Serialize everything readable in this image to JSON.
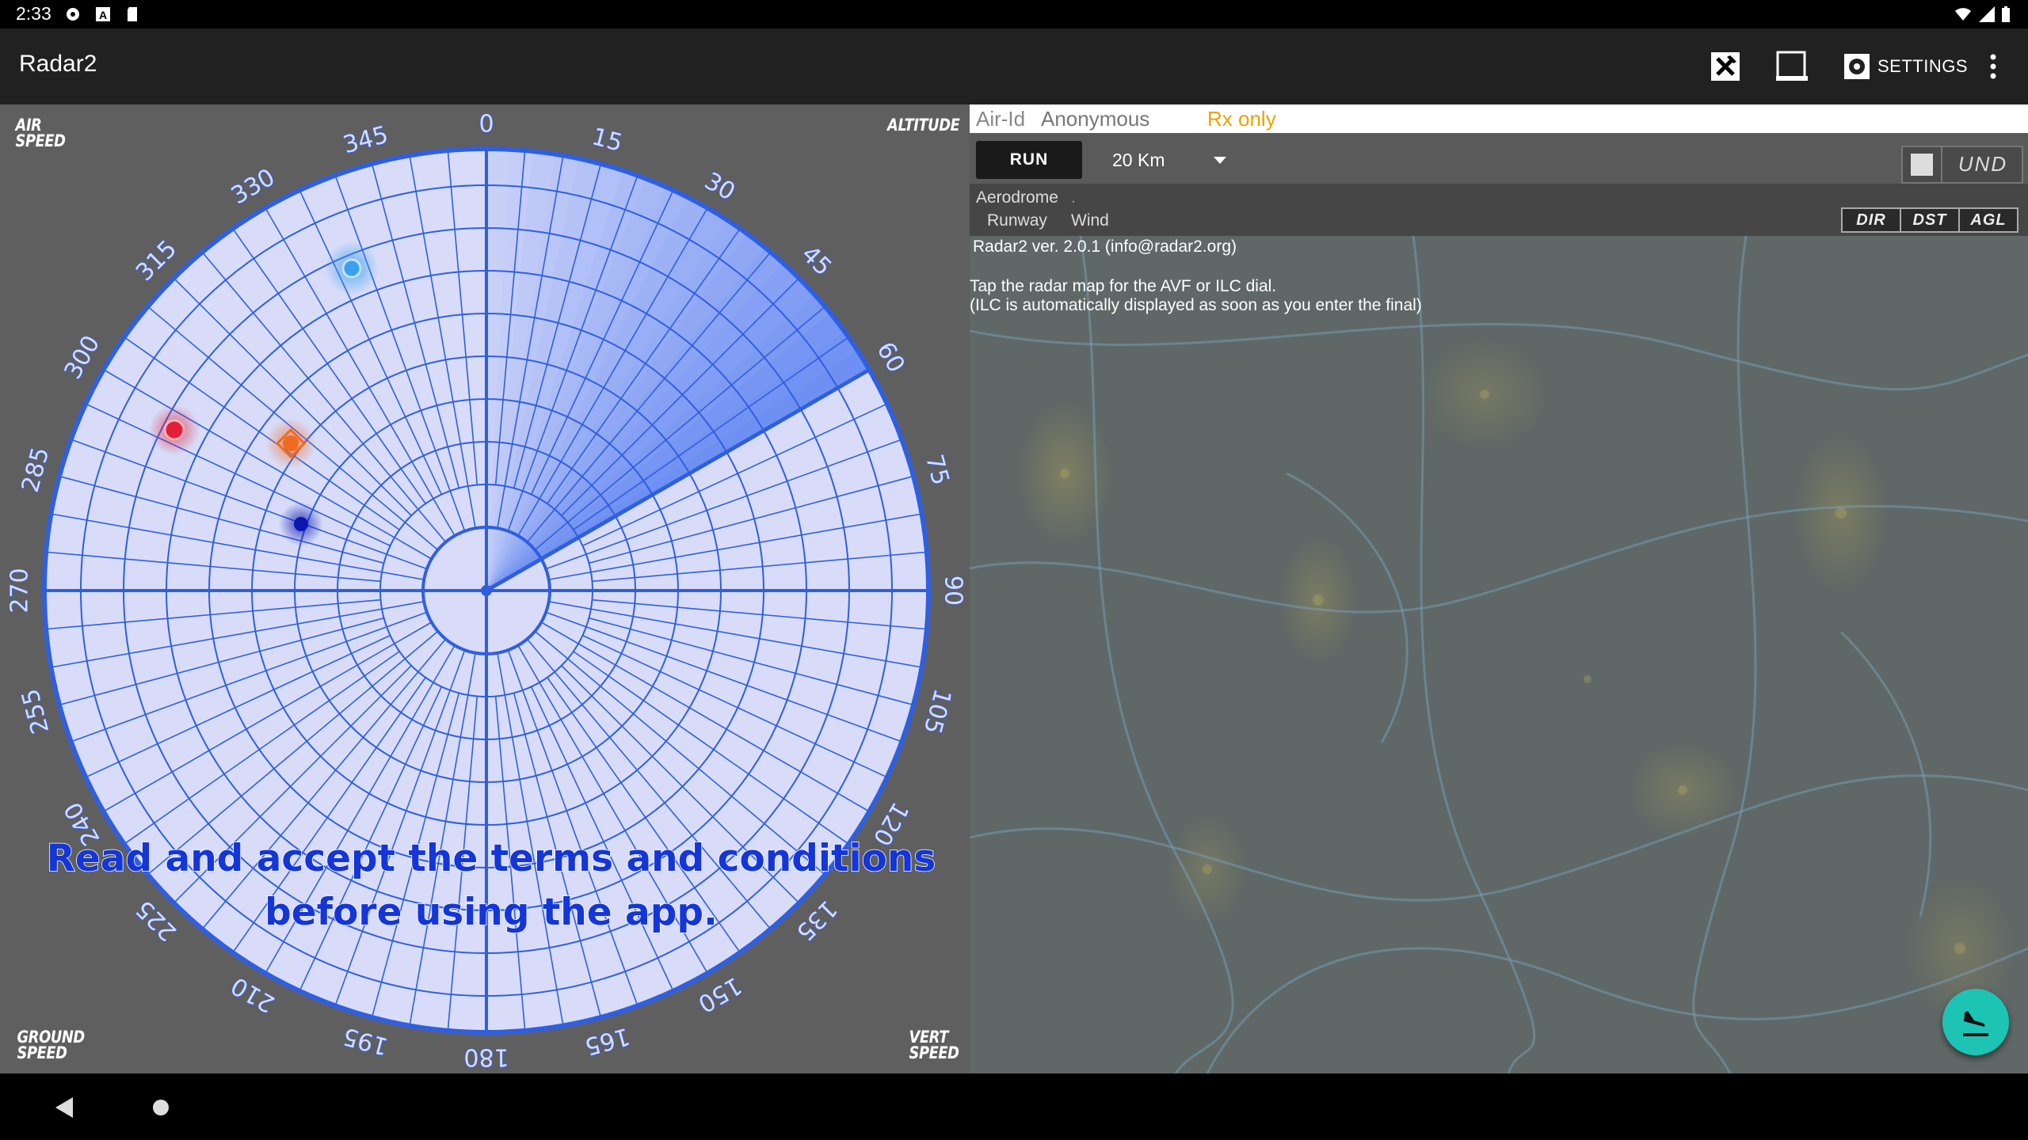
{
  "status_bar": {
    "time": "2:33"
  },
  "app_bar": {
    "title": "Radar2",
    "settings_label": "SETTINGS",
    "acas_icon_text": "ACAS ILC"
  },
  "radar": {
    "corner_labels": {
      "top_left": [
        "AIR",
        "SPEED"
      ],
      "top_right": "ALTITUDE",
      "bottom_left": [
        "GROUND",
        "SPEED"
      ],
      "bottom_right": [
        "VERT",
        "SPEED"
      ]
    },
    "bearings": [
      "0",
      "15",
      "30",
      "45",
      "60",
      "75",
      "90",
      "105",
      "120",
      "135",
      "150",
      "165",
      "180",
      "195",
      "210",
      "225",
      "240",
      "255",
      "270",
      "285",
      "300",
      "315",
      "330",
      "345"
    ],
    "notice_line1": "Read and accept the terms and conditions",
    "notice_line2": "before using the app.",
    "colors": {
      "background": "#5f5f5f",
      "disc": "#d8dcf8",
      "grid": "#2f5fe0",
      "sweep": "#3a6af0"
    },
    "targets": [
      {
        "color": "#3aa0f0",
        "label": "blue target"
      },
      {
        "color": "#e0203a",
        "label": "red target"
      },
      {
        "color": "#f06a20",
        "label": "orange target"
      },
      {
        "color": "#0a18b0",
        "label": "dark blue target"
      }
    ]
  },
  "right_panel": {
    "air_id_label": "Air-Id",
    "air_id_value": "Anonymous",
    "mode": "Rx only",
    "run_label": "RUN",
    "range_value": "20 Km",
    "und_label": "UND",
    "aerodrome_label": "Aerodrome",
    "aerodrome_value": ".",
    "runway_label": "Runway",
    "wind_label": "Wind",
    "tabs": [
      "DIR",
      "DST",
      "AGL"
    ],
    "map_text": [
      "Radar2  ver. 2.0.1  (info@radar2.org)",
      "",
      "Tap the radar map for the AVF or ILC dial.",
      "(ILC is automatically displayed as soon as you enter the final)"
    ]
  }
}
